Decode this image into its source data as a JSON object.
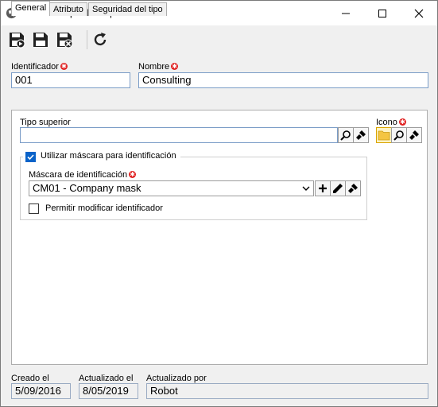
{
  "window": {
    "title": "Datos del tipo de empresa"
  },
  "toolbar": {
    "buttons": [
      "save-icon",
      "save-new-icon",
      "save-close-icon",
      "refresh-icon"
    ]
  },
  "form": {
    "identificador_label": "Identificador",
    "identificador_value": "001",
    "nombre_label": "Nombre",
    "nombre_value": "Consulting"
  },
  "tabs": [
    {
      "label": "General",
      "active": true
    },
    {
      "label": "Atributo",
      "active": false
    },
    {
      "label": "Seguridad del tipo",
      "active": false
    }
  ],
  "general": {
    "tipo_superior_label": "Tipo superior",
    "tipo_superior_value": "",
    "icono_label": "Icono",
    "mask_checkbox_label": "Utilizar máscara para identificación",
    "mask_checked": true,
    "mask_label": "Máscara de identificación",
    "mask_value": "CM01 - Company mask",
    "permit_label": "Permitir modificar identificador",
    "permit_checked": false
  },
  "footer": {
    "creado_label": "Creado el",
    "creado_value": "5/09/2016",
    "actualizado_label": "Actualizado el",
    "actualizado_value": "8/05/2019",
    "actualizado_por_label": "Actualizado por",
    "actualizado_por_value": "Robot"
  },
  "colors": {
    "required": "#e02020",
    "field_border": "#7a9cc7",
    "checkbox": "#0a63c9",
    "folder": "#f4c542"
  }
}
